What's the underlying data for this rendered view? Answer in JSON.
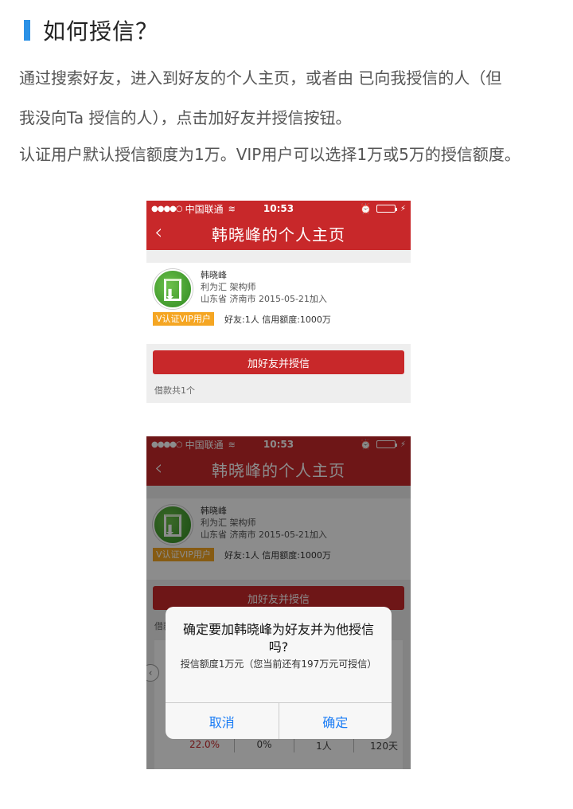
{
  "header": {
    "title": "如何授信？"
  },
  "paragraphs": {
    "p1": "通过搜索好友，进入到好友的个人主页，或者由 已向我授信的人（但",
    "p2": "我没向Ta 授信的人），点击加好友并授信按钮。",
    "p3": "认证用户默认授信额度为1万。VIP用户可以选择1万或5万的授信额度。"
  },
  "phone": {
    "status": {
      "dots": "●●●●○",
      "carrier": "中国联通",
      "wifi": "≋",
      "time": "10:53",
      "alarm": "⏰",
      "bolt": "⚡"
    },
    "nav": {
      "back": "‹",
      "title": "韩晓峰的个人主页"
    },
    "profile": {
      "name": "韩晓峰",
      "company": "利为汇 架构师",
      "location": "山东省 济南市 2015-05-21加入",
      "badge": "V认证VIP用户",
      "stats": "好友:1人  信用额度:1000万"
    },
    "add_button": "加好友并授信",
    "loan_count": "借款共1个"
  },
  "loan_row": {
    "rate": "22.0%",
    "v2": "0%",
    "v3": "1人",
    "v4": "120天"
  },
  "dialog": {
    "title": "确定要加韩晓峰为好友并为他授信吗?",
    "message": "授信额度1万元（您当前还有197万元可授信）",
    "cancel": "取消",
    "confirm": "确定"
  },
  "colors": {
    "accent_blue": "#2b91e6",
    "brand_red": "#c8282a",
    "vip_orange": "#f5a623",
    "ios_blue": "#1a7cf5"
  }
}
